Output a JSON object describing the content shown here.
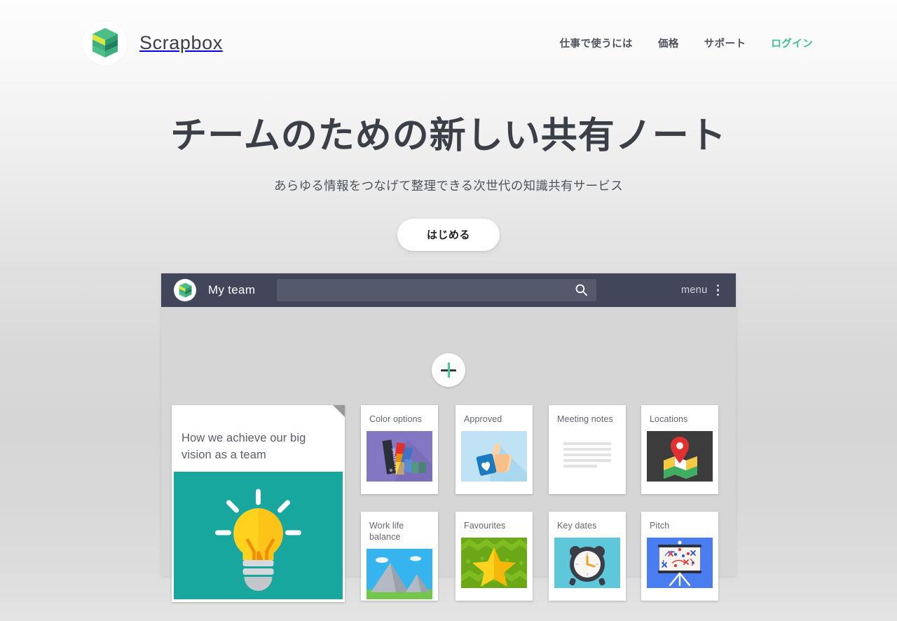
{
  "header": {
    "brand_name": "Scrapbox",
    "logo_icon": "scrapbox-s-logo-icon",
    "nav": [
      {
        "label": "仕事で使うには",
        "accent": false
      },
      {
        "label": "価格",
        "accent": false
      },
      {
        "label": "サポート",
        "accent": false
      },
      {
        "label": "ログイン",
        "accent": true
      }
    ]
  },
  "hero": {
    "title": "チームのための新しい共有ノート",
    "subtitle": "あらゆる情報をつなげて整理できる次世代の知識共有サービス",
    "cta_label": "はじめる"
  },
  "app_preview": {
    "logo_icon": "scrapbox-s-logo-icon",
    "team_name": "My team",
    "search_placeholder": "",
    "search_value": "",
    "search_icon": "search-icon",
    "menu_label": "menu",
    "kebab_icon": "more-vertical-icon",
    "add_button_icon": "plus-icon",
    "featured_card": {
      "title": "How we achieve our big vision as a team",
      "thumb_icon": "lightbulb-icon",
      "thumb_color": "#17a79e"
    },
    "cards": [
      {
        "title": "Color options",
        "thumb_icon": "pantone-swatch-icon",
        "thumb_color": "#8377c4"
      },
      {
        "title": "Approved",
        "thumb_icon": "thumbs-up-card-icon",
        "thumb_color": "#bfe2f5"
      },
      {
        "title": "Meeting notes",
        "thumb_icon": "text-lines-icon",
        "thumb_color": "#ffffff"
      },
      {
        "title": "Locations",
        "thumb_icon": "map-pin-icon",
        "thumb_color": "#3c3c3c"
      },
      {
        "title": "Work life balance",
        "thumb_icon": "mountain-landscape-icon",
        "thumb_color": "#35b4f0"
      },
      {
        "title": "Favourites",
        "thumb_icon": "star-icon",
        "thumb_color": "#6aa818"
      },
      {
        "title": "Key dates",
        "thumb_icon": "alarm-clock-icon",
        "thumb_color": "#5ec8da"
      },
      {
        "title": "Pitch",
        "thumb_icon": "strategy-board-icon",
        "thumb_color": "#4a7ef0"
      }
    ]
  },
  "colors": {
    "accent_green": "#3ec28f",
    "app_bar": "#41465a",
    "text_dark": "#3b4048"
  }
}
